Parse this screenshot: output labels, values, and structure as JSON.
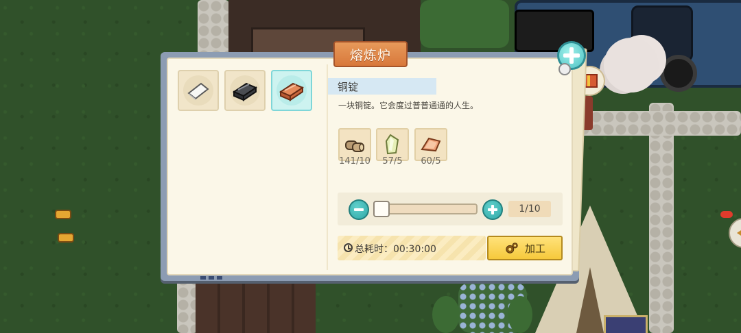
{
  "dialog": {
    "title": "熔炼炉",
    "close_icon": "close-plus-icon"
  },
  "recipes": [
    {
      "name": "iron-sheet",
      "icon": "silver-sheet-icon",
      "selected": false
    },
    {
      "name": "iron-ingot",
      "icon": "iron-ingot-icon",
      "selected": false
    },
    {
      "name": "copper-ingot",
      "icon": "copper-ingot-icon",
      "selected": true
    }
  ],
  "item": {
    "name": "铜锭",
    "description": "一块铜锭。它会度过普普通通的人生。"
  },
  "materials": [
    {
      "icon": "wood-log-icon",
      "count": "141/10"
    },
    {
      "icon": "crystal-shard-icon",
      "count": "57/5"
    },
    {
      "icon": "copper-ore-icon",
      "count": "60/5"
    }
  ],
  "quantity": {
    "readout": "1/10",
    "current": 1,
    "max": 10
  },
  "time": {
    "label": "总耗时：",
    "value": "00:30:00"
  },
  "process_button": {
    "label": "加工"
  },
  "colors": {
    "accent_teal": "#2fa9a8",
    "title_orange": "#d8783b",
    "button_yellow": "#f6c93c",
    "selected_slot": "#cdf3f0"
  }
}
